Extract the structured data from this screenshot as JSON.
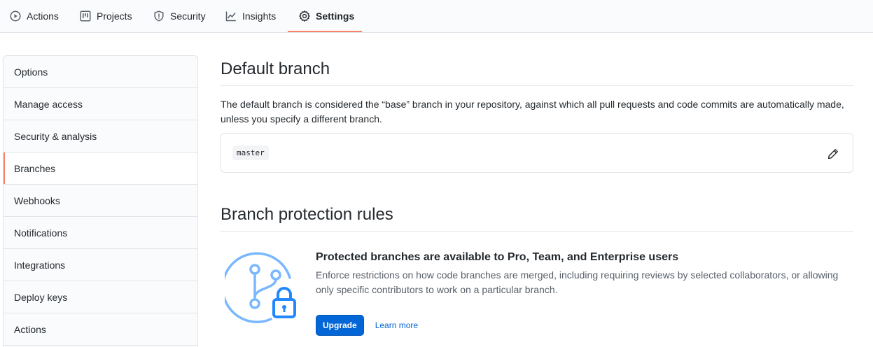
{
  "tabs": [
    {
      "label": "Actions",
      "icon": "play-circle-icon"
    },
    {
      "label": "Projects",
      "icon": "project-board-icon"
    },
    {
      "label": "Security",
      "icon": "shield-icon"
    },
    {
      "label": "Insights",
      "icon": "graph-icon"
    },
    {
      "label": "Settings",
      "icon": "gear-icon",
      "active": true
    }
  ],
  "sidebar": {
    "items": [
      {
        "label": "Options"
      },
      {
        "label": "Manage access"
      },
      {
        "label": "Security & analysis"
      },
      {
        "label": "Branches",
        "selected": true
      },
      {
        "label": "Webhooks"
      },
      {
        "label": "Notifications"
      },
      {
        "label": "Integrations"
      },
      {
        "label": "Deploy keys"
      },
      {
        "label": "Actions"
      }
    ]
  },
  "default_branch": {
    "title": "Default branch",
    "description": "The default branch is considered the “base” branch in your repository, against which all pull requests and code commits are automatically made, unless you specify a different branch.",
    "branch_name": "master",
    "edit_icon": "pencil-icon"
  },
  "protection": {
    "title": "Branch protection rules",
    "heading": "Protected branches are available to Pro, Team, and Enterprise users",
    "body": "Enforce restrictions on how code branches are merged, including requiring reviews by selected collaborators, or allowing only specific contributors to work on a particular branch.",
    "upgrade_label": "Upgrade",
    "learn_more_label": "Learn more",
    "illustration_icon": "branch-lock-icon"
  },
  "colors": {
    "accent_underline": "#f9826c",
    "primary_button": "#0366d6",
    "illustration_blue": "#79b8ff",
    "lock_blue": "#2188ff"
  }
}
